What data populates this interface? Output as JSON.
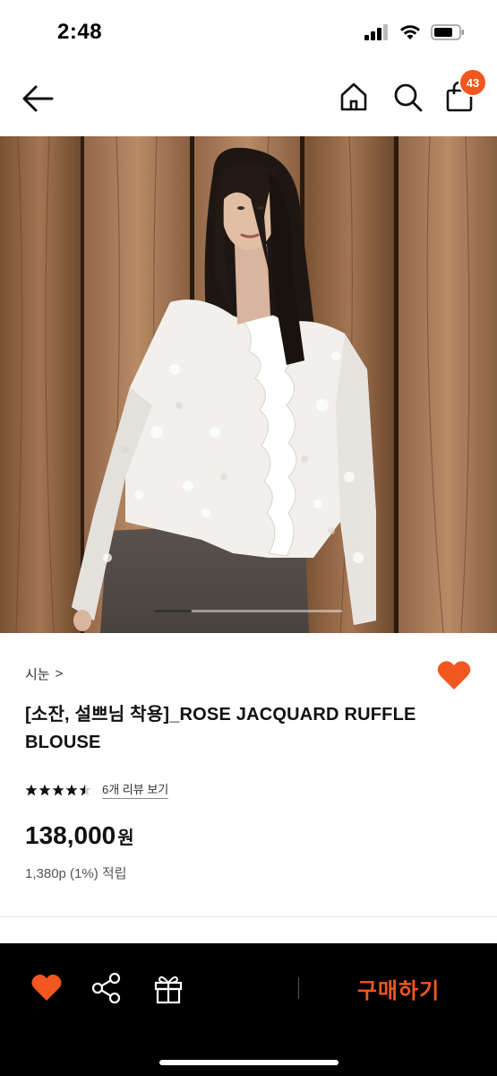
{
  "status_bar": {
    "time": "2:48"
  },
  "nav": {
    "back_icon": "arrow-left-icon",
    "home_icon": "home-icon",
    "search_icon": "search-icon",
    "cart_icon": "shopping-bag-icon",
    "cart_count": "43"
  },
  "product": {
    "image_alt": "Model wearing white rose jacquard ruffle blouse against wooden wall",
    "brand": "시눈",
    "brand_chevron": ">",
    "title": "[소잔, 설쁘님 착용]_ROSE JACQUARD RUFFLE BLOUSE",
    "rating": 4.5,
    "stars": "★★★★★",
    "review_link": "6개 리뷰 보기",
    "price": "138,000",
    "price_unit": "원",
    "points": "1,380p (1%) 적립",
    "carousel_position": 0.2
  },
  "bottom_bar": {
    "heart_icon": "heart-icon",
    "share_icon": "share-icon",
    "gift_icon": "gift-icon",
    "buy_label": "구매하기"
  },
  "colors": {
    "accent": "#f2571f",
    "bottom_bar": "#000000",
    "text": "#111111"
  }
}
